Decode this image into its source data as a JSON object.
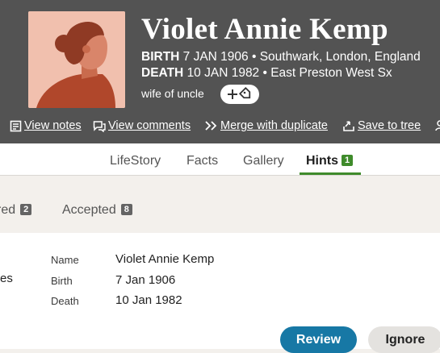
{
  "person": {
    "name": "Violet Annie Kemp",
    "birth_label": "BIRTH",
    "birth_value": "7 JAN 1906 • Southwark, London, England",
    "death_label": "DEATH",
    "death_value": "10 JAN 1982 • East Preston West Sx",
    "relation": "wife of uncle"
  },
  "actions": [
    {
      "label": "View notes",
      "icon": "notes-icon"
    },
    {
      "label": "View comments",
      "icon": "comments-icon"
    },
    {
      "label": "Merge with duplicate",
      "icon": "merge-icon"
    },
    {
      "label": "Save to tree",
      "icon": "save-icon"
    }
  ],
  "tabs": [
    {
      "label": "LifeStory"
    },
    {
      "label": "Facts"
    },
    {
      "label": "Gallery"
    },
    {
      "label": "Hints",
      "count": "1",
      "active": true
    }
  ],
  "subtabs": [
    {
      "label": "red",
      "count": "2"
    },
    {
      "label": "Accepted",
      "count": "8"
    }
  ],
  "hint": {
    "cut_label": "es",
    "rows": [
      {
        "label": "Name",
        "value": "Violet Annie Kemp"
      },
      {
        "label": "Birth",
        "value": "7 Jan 1906"
      },
      {
        "label": "Death",
        "value": "10 Jan 1982"
      }
    ],
    "review_label": "Review",
    "ignore_label": "Ignore"
  },
  "colors": {
    "header": "#535353",
    "accent_green": "#3f8b2b",
    "review_blue": "#1778a5",
    "avatar_bg": "#f1c0ae"
  }
}
